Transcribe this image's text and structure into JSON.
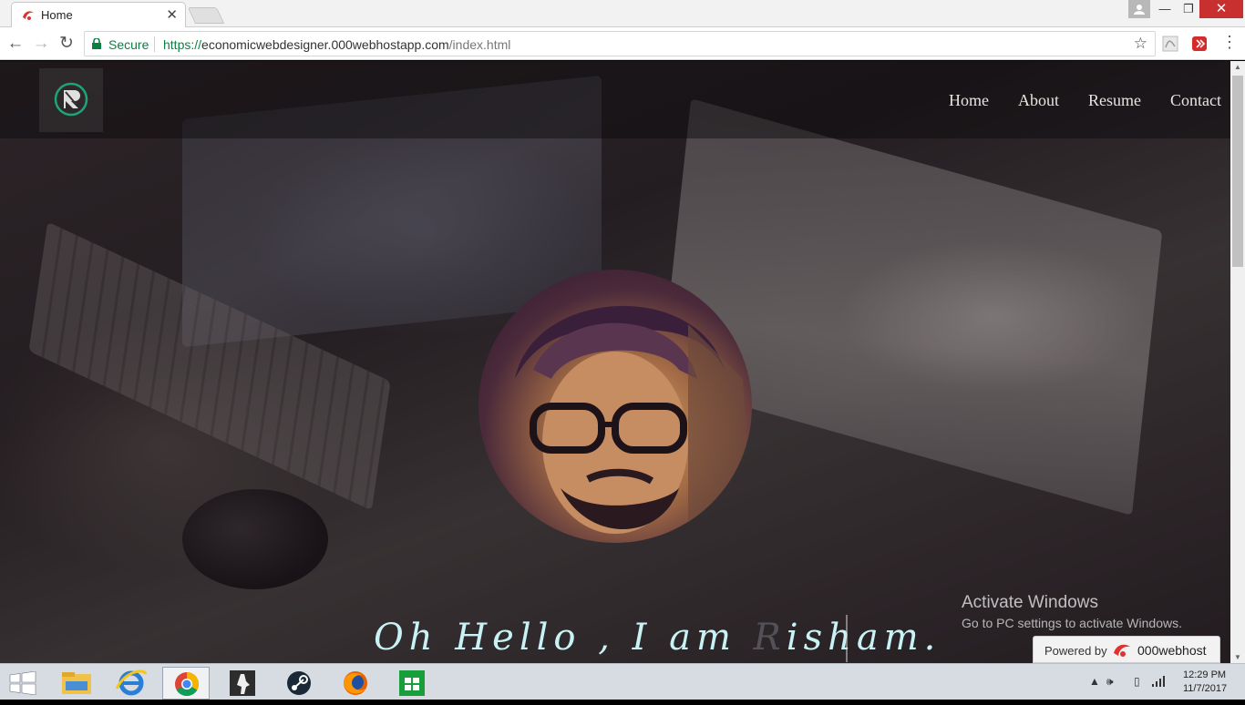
{
  "browser": {
    "tab_title": "Home",
    "tab_close": "✕",
    "secure_label": "Secure",
    "url_scheme": "https://",
    "url_host": "economicwebdesigner.000webhostapp.com",
    "url_path": "/index.html",
    "window_min": "—",
    "window_max": "❐",
    "window_close": "✕"
  },
  "site": {
    "nav": {
      "home": "Home",
      "about": "About",
      "resume": "Resume",
      "contact": "Contact"
    },
    "hero": {
      "greeting_part1": "Oh Hello , I am ",
      "greeting_ghost": "R",
      "greeting_part2": "isham."
    }
  },
  "overlay": {
    "activate_title": "Activate Windows",
    "activate_sub": "Go to PC settings to activate Windows.",
    "powered_label": "Powered by",
    "powered_brand": "000webhost"
  },
  "taskbar": {
    "clock_time": "12:29 PM",
    "clock_date": "11/7/2017"
  },
  "colors": {
    "secure_green": "#0b8043",
    "close_red": "#c7302e",
    "hero_text": "#c9f2f5"
  }
}
